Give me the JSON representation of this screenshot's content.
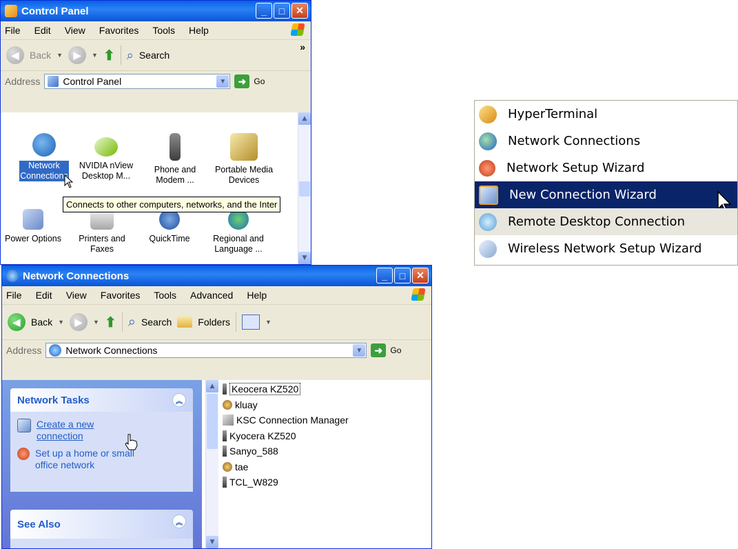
{
  "control_panel": {
    "title": "Control Panel",
    "menu": [
      "File",
      "Edit",
      "View",
      "Favorites",
      "Tools",
      "Help"
    ],
    "back_label": "Back",
    "search_label": "Search",
    "overflow": "»",
    "address_label": "Address",
    "address_value": "Control Panel",
    "go_label": "Go",
    "items": [
      {
        "label1": "Network",
        "label2": "Connections",
        "icon": "network-globe-icon"
      },
      {
        "label1": "NVIDIA nView",
        "label2": "Desktop M...",
        "icon": "nvidia-icon"
      },
      {
        "label1": "Phone and",
        "label2": "Modem ...",
        "icon": "phone-modem-icon"
      },
      {
        "label1": "Portable Media",
        "label2": "Devices",
        "icon": "portable-media-icon"
      },
      {
        "label1": "Power Options",
        "label2": "",
        "icon": "power-options-icon"
      },
      {
        "label1": "Printers and",
        "label2": "Faxes",
        "icon": "printer-icon"
      },
      {
        "label1": "QuickTime",
        "label2": "",
        "icon": "quicktime-icon"
      },
      {
        "label1": "Regional and",
        "label2": "Language ...",
        "icon": "regional-globe-icon"
      }
    ],
    "tooltip": "Connects to other computers, networks, and the Inter"
  },
  "network_connections": {
    "title": "Network Connections",
    "menu": [
      "File",
      "Edit",
      "View",
      "Favorites",
      "Tools",
      "Advanced",
      "Help"
    ],
    "back_label": "Back",
    "search_label": "Search",
    "folders_label": "Folders",
    "address_label": "Address",
    "address_value": "Network Connections",
    "go_label": "Go",
    "network_tasks": {
      "heading": "Network Tasks",
      "create_1": "Create a new",
      "create_2": "connection",
      "setup_1": "Set up a home or small",
      "setup_2": "office network"
    },
    "see_also": {
      "heading": "See Also"
    },
    "connections": [
      "Keocera KZ520",
      "kluay",
      "KSC Connection Manager",
      "Kyocera KZ520",
      "Sanyo_588",
      "tae",
      "TCL_W829"
    ]
  },
  "context_menu": {
    "items": [
      "HyperTerminal",
      "Network Connections",
      "Network Setup Wizard",
      "New Connection Wizard",
      "Remote Desktop Connection",
      "Wireless Network Setup Wizard"
    ]
  },
  "colors": {
    "xp_blue": "#0a5fe3",
    "selected": "#0a246a",
    "tooltip": "#ffffe1",
    "task_blue": "#215dc6"
  }
}
